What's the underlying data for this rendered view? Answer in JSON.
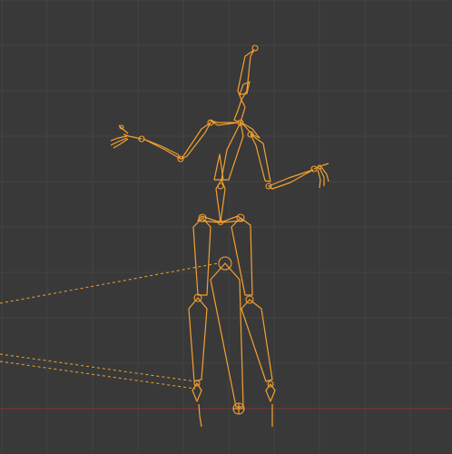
{
  "viewport": {
    "mode": "pose",
    "background_color": "#393939",
    "grid_color": "#434343",
    "x_axis_color": "#7a3434"
  },
  "armature": {
    "selection_color": "#f5a030",
    "display": "octahedral",
    "selected": true
  }
}
